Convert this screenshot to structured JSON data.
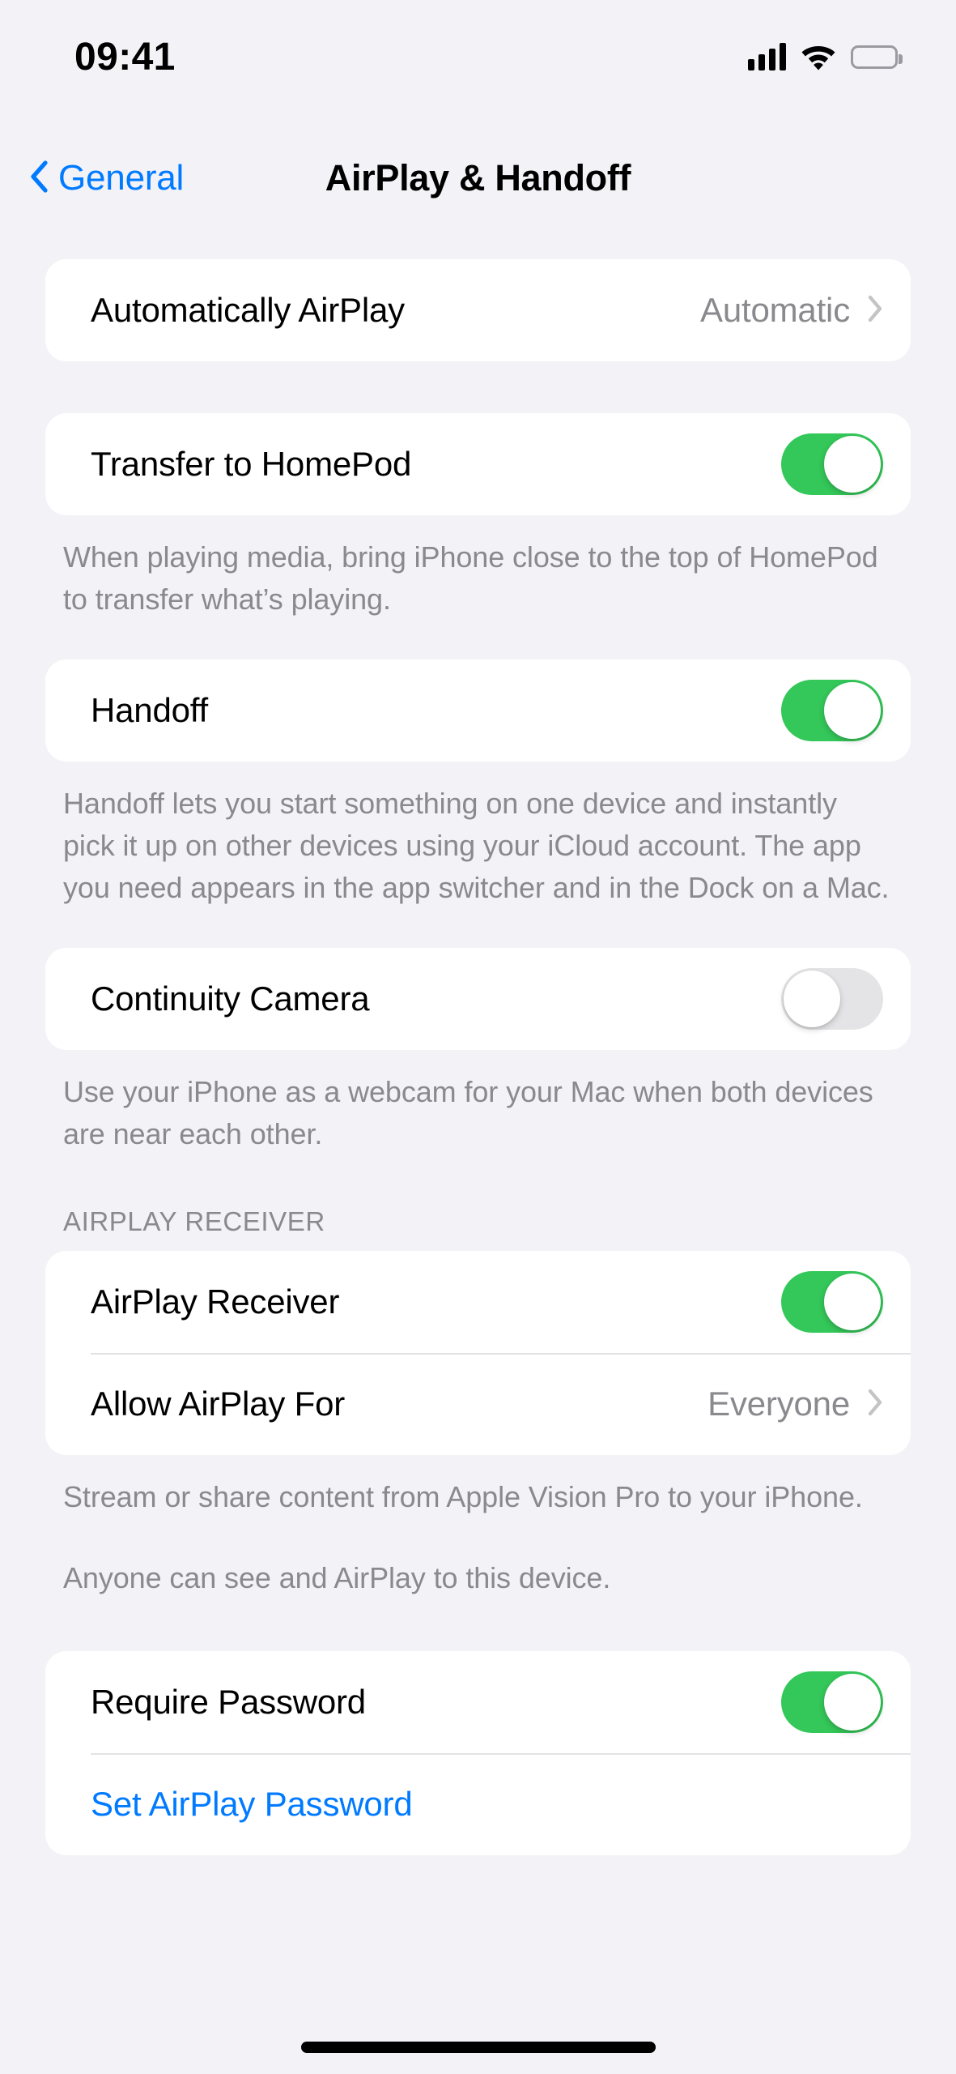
{
  "status_bar": {
    "time": "09:41",
    "cellular_icon": "signal-bars-icon",
    "wifi_icon": "wifi-icon",
    "battery_icon": "battery-full-icon"
  },
  "nav": {
    "back_label": "General",
    "back_icon": "chevron-left-icon",
    "title": "AirPlay & Handoff"
  },
  "sections": {
    "automatically_airplay": {
      "label": "Automatically AirPlay",
      "value": "Automatic",
      "chevron_icon": "chevron-right-icon"
    },
    "transfer_homepod": {
      "label": "Transfer to HomePod",
      "toggle_state": "on",
      "footer": "When playing media, bring iPhone close to the top of HomePod to transfer what’s playing."
    },
    "handoff": {
      "label": "Handoff",
      "toggle_state": "on",
      "footer": "Handoff lets you start something on one device and instantly pick it up on other devices using your iCloud account. The app you need appears in the app switcher and in the Dock on a Mac."
    },
    "continuity_camera": {
      "label": "Continuity Camera",
      "toggle_state": "off",
      "footer": "Use your iPhone as a webcam for your Mac when both devices are near each other."
    },
    "airplay_receiver": {
      "header": "AIRPLAY RECEIVER",
      "receiver_label": "AirPlay Receiver",
      "receiver_toggle_state": "on",
      "allow_label": "Allow AirPlay For",
      "allow_value": "Everyone",
      "allow_chevron_icon": "chevron-right-icon",
      "footer_1": "Stream or share content from Apple Vision Pro to your iPhone.",
      "footer_2": "Anyone can see and AirPlay to this device."
    },
    "password": {
      "require_label": "Require Password",
      "require_toggle_state": "on",
      "set_password_label": "Set AirPlay Password"
    }
  },
  "colors": {
    "accent_blue": "#007AFF",
    "toggle_on_green": "#34C759",
    "toggle_off_gray": "#E4E4E6",
    "background": "#F2F2F7",
    "card": "#FFFFFF",
    "secondary_text": "#8A8A8E"
  }
}
